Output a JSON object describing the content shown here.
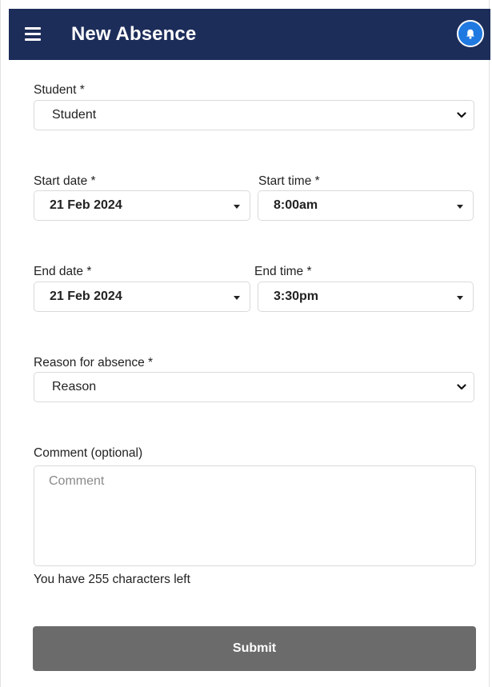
{
  "header": {
    "title": "New Absence",
    "menu_icon": "hamburger-menu-icon",
    "notifications_icon": "bell-icon",
    "bar_color": "#1d2d5a",
    "bell_color": "#2079e0"
  },
  "form": {
    "student": {
      "label": "Student *",
      "value": "Student"
    },
    "start_date": {
      "label": "Start date *",
      "value": "21 Feb 2024"
    },
    "start_time": {
      "label": "Start time *",
      "value": "8:00am"
    },
    "end_date": {
      "label": "End date *",
      "value": "21 Feb 2024"
    },
    "end_time": {
      "label": "End time *",
      "value": "3:30pm"
    },
    "reason": {
      "label": "Reason for absence *",
      "value": "Reason"
    },
    "comment": {
      "label": "Comment (optional)",
      "placeholder": "Comment",
      "value": ""
    },
    "counter": "You have 255 characters left",
    "submit_label": "Submit",
    "submit_color": "#6b6b6b"
  }
}
